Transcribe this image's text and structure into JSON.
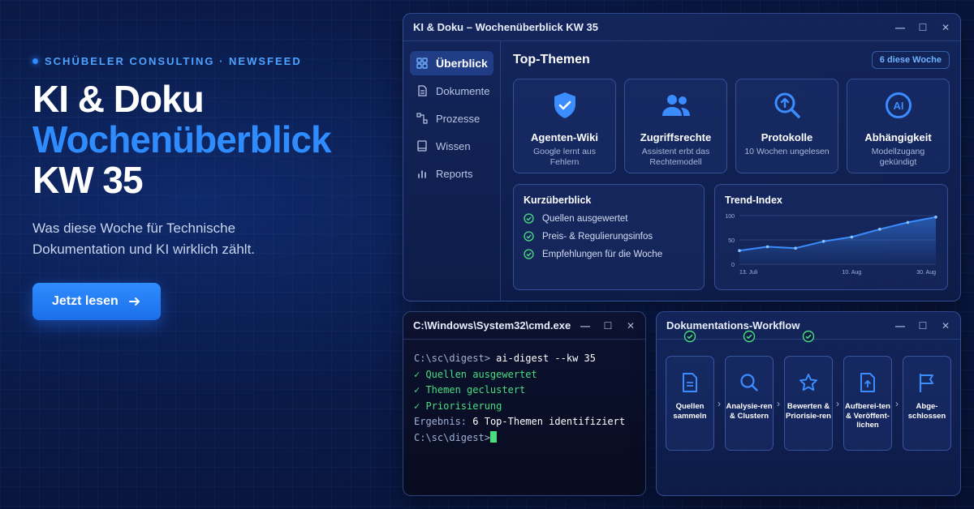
{
  "hero": {
    "brand": "SCHÜBELER CONSULTING · NEWSFEED",
    "headline_1": "KI & Doku",
    "headline_2": "Wochenüberblick",
    "headline_3": "KW 35",
    "subtitle": "Was diese Woche für Technische Dokumentation und KI wirklich zählt.",
    "cta_label": "Jetzt lesen",
    "cta_icon": "arrow-right-icon"
  },
  "main_window": {
    "title": "KI & Doku – Wochenüberblick KW 35",
    "sidebar": [
      {
        "label": "Überblick",
        "icon": "grid-icon",
        "active": true
      },
      {
        "label": "Dokumente",
        "icon": "document-icon",
        "active": false
      },
      {
        "label": "Prozesse",
        "icon": "process-icon",
        "active": false
      },
      {
        "label": "Wissen",
        "icon": "book-icon",
        "active": false
      },
      {
        "label": "Reports",
        "icon": "bar-chart-icon",
        "active": false
      }
    ],
    "section_title": "Top-Themen",
    "badge": "6 diese Woche",
    "cards": [
      {
        "title": "Agenten-Wiki",
        "subtitle": "Google lernt aus Fehlern",
        "icon": "shield-check-icon"
      },
      {
        "title": "Zugriffsrechte",
        "subtitle": "Assistent erbt das Rechtemodell",
        "icon": "users-icon"
      },
      {
        "title": "Protokolle",
        "subtitle": "10 Wochen ungelesen",
        "icon": "search-upload-icon"
      },
      {
        "title": "Abhängigkeit",
        "subtitle": "Modellzugang gekündigt",
        "icon": "ai-icon"
      }
    ],
    "summary": {
      "title": "Kurzüberblick",
      "items": [
        "Quellen ausgewertet",
        "Preis- & Regulierungsinfos",
        "Empfehlungen für die Woche"
      ]
    },
    "trend": {
      "title": "Trend-Index"
    }
  },
  "chart_data": {
    "type": "area",
    "title": "Trend-Index",
    "x": [
      "13. Juli",
      "20. Juli",
      "27. Juli",
      "3. Aug",
      "10. Aug",
      "17. Aug",
      "24. Aug",
      "30. Aug"
    ],
    "x_tick_labels": [
      "13. Juli",
      "10. Aug",
      "30. Aug"
    ],
    "series": [
      {
        "values": [
          28,
          36,
          33,
          47,
          56,
          72,
          86,
          97
        ]
      }
    ],
    "y_ticks": [
      0,
      50,
      100
    ],
    "ylim": [
      0,
      100
    ],
    "grid": true,
    "accent_color": "#3b8cff"
  },
  "terminal": {
    "title": "C:\\Windows\\System32\\cmd.exe",
    "prompt": "C:\\sc\\digest>",
    "command": "ai-digest --kw 35",
    "ok_lines": [
      "✓ Quellen ausgewertet",
      "✓ Themen geclustert",
      "✓ Priorisierung"
    ],
    "result_label": "Ergebnis:",
    "result_value": "6 Top-Themen identifiziert"
  },
  "workflow": {
    "title": "Dokumentations-Workflow",
    "steps": [
      {
        "label": "Quellen sammeln",
        "icon": "document-icon",
        "done": true
      },
      {
        "label": "Analysie-ren & Clustern",
        "icon": "search-icon",
        "done": true
      },
      {
        "label": "Bewerten & Priorisie-ren",
        "icon": "star-icon",
        "done": true
      },
      {
        "label": "Aufberei-ten & Veröffent-lichen",
        "icon": "upload-file-icon",
        "done": false
      },
      {
        "label": "Abge-schlossen",
        "icon": "flag-icon",
        "done": false
      }
    ]
  },
  "colors": {
    "accent": "#2f8cff",
    "success": "#4ade80",
    "background": "#0a1a48"
  }
}
